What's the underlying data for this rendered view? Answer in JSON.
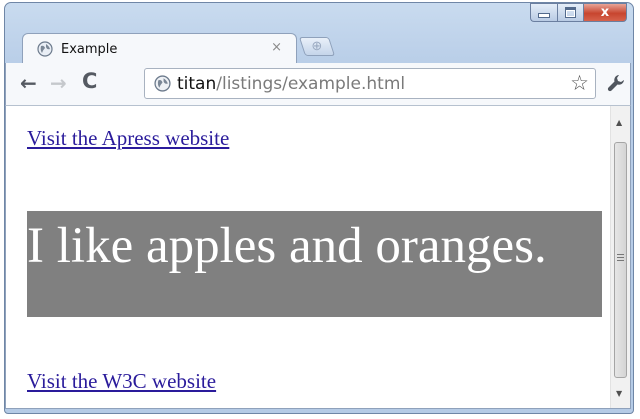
{
  "window": {
    "caption_buttons": {
      "minimize_icon": "minimize-icon",
      "maximize_icon": "maximize-icon",
      "close_label": "x"
    }
  },
  "tab": {
    "title": "Example",
    "close_label": "×",
    "favicon": "globe-icon"
  },
  "toolbar": {
    "back_label": "←",
    "forward_label": "→",
    "reload_label": "C",
    "url_host": "titan",
    "url_path": "/listings/example.html",
    "bookmark_label": "☆",
    "wrench_icon": "wrench-icon"
  },
  "page": {
    "link_apress": "Visit the Apress website",
    "block_text": "I like apples and oranges.",
    "block_color": "#808080",
    "link_w3c": "Visit the W3C website"
  },
  "scrollbar": {
    "up_label": "▲",
    "down_label": "▼"
  }
}
